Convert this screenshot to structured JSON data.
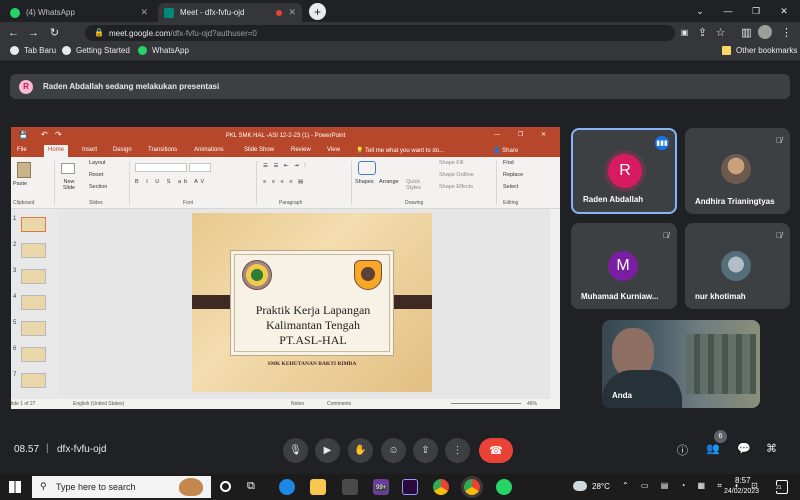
{
  "browser": {
    "tabs": [
      {
        "title": "(4) WhatsApp",
        "active": false
      },
      {
        "title": "Meet - dfx-fvfu-ojd",
        "active": true
      }
    ],
    "url_host": "meet.google.com",
    "url_path": "/dfx-fvfu-ojd?authuser=0",
    "bookmarks": [
      "Tab Baru",
      "Getting Started",
      "WhatsApp"
    ],
    "other_bookmarks": "Other bookmarks"
  },
  "meet": {
    "banner_avatar": "R",
    "banner_text": "Raden Abdallah sedang melakukan presentasi",
    "time": "08.57",
    "meeting_code": "dfx-fvfu-ojd",
    "participant_count": "6",
    "participants": [
      {
        "name": "Raden Abdallah",
        "initial": "R",
        "color": "#d81b60",
        "speaking": true
      },
      {
        "name": "Andhira Trianingtyas",
        "initial": "",
        "color": "#a1887f"
      },
      {
        "name": "Muhamad Kurniaw...",
        "initial": "M",
        "color": "#7b1fa2"
      },
      {
        "name": "nur khotimah",
        "initial": "",
        "color": "#90a4ae"
      },
      {
        "name": "Anda",
        "initial": "",
        "color": "#455a64"
      }
    ]
  },
  "ppt": {
    "window_title": "PKL SMK HAL -ASI 12-2-23 (1) - PowerPoint",
    "tell_me": "Tell me what you want to do...",
    "share": "Share",
    "menu": [
      "File",
      "Home",
      "Insert",
      "Design",
      "Transitions",
      "Animations",
      "Slide Show",
      "Review",
      "View"
    ],
    "ribbon": {
      "paste": "Paste",
      "new_slide": "New Slide",
      "layout": "Layout",
      "reset": "Reset",
      "section": "Section",
      "shapes": "Shapes",
      "arrange": "Arrange",
      "quick_styles": "Quick Styles",
      "shape_fill": "Shape Fill",
      "shape_outline": "Shape Outline",
      "shape_effects": "Shape Effects",
      "find": "Find",
      "replace": "Replace",
      "select": "Select",
      "groups": [
        "Clipboard",
        "Slides",
        "Font",
        "Paragraph",
        "Drawing",
        "Editing"
      ]
    },
    "thumb_numbers": [
      "1",
      "2",
      "3",
      "4",
      "5",
      "6",
      "7"
    ],
    "status": {
      "slide": "lide 1 of 27",
      "language": "English (United States)",
      "notes": "Notes",
      "comments": "Comments",
      "zoom": "46%"
    },
    "slide": {
      "line1": "Praktik Kerja Lapangan",
      "line2": "Kalimantan Tengah",
      "line3": "PT.ASL-HAL",
      "footer": "SMK KEHUTANAN BAKTI RIMBA"
    }
  },
  "taskbar": {
    "search_placeholder": "Type here to search",
    "temperature": "28°C",
    "clock_time": "8:57",
    "clock_date": "24/02/2023",
    "notif_count": "21",
    "badge": "99+"
  }
}
